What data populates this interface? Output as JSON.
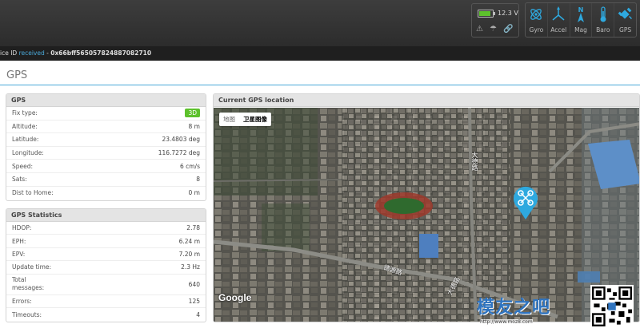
{
  "header": {
    "voltage": "12.3 V",
    "battery_level": 0.85,
    "sensors": [
      {
        "label": "Gyro",
        "icon": "gyro-icon"
      },
      {
        "label": "Accel",
        "icon": "accel-icon"
      },
      {
        "label": "Mag",
        "icon": "mag-icon"
      },
      {
        "label": "Baro",
        "icon": "baro-icon"
      },
      {
        "label": "GPS",
        "icon": "gps-icon"
      }
    ]
  },
  "device": {
    "prefix": "ice ID ",
    "received": "received",
    "separator": " - ",
    "id": "0x66bff565057824887082710"
  },
  "page": {
    "title": "GPS"
  },
  "gps": {
    "title": "GPS",
    "fix_label": "Fix type:",
    "fix_value": "3D",
    "rows": [
      {
        "label": "Altitude:",
        "value": "8 m"
      },
      {
        "label": "Latitude:",
        "value": "23.4803 deg"
      },
      {
        "label": "Longitude:",
        "value": "116.7272 deg"
      },
      {
        "label": "Speed:",
        "value": "6 cm/s"
      },
      {
        "label": "Sats:",
        "value": "8"
      },
      {
        "label": "Dist to Home:",
        "value": "0 m"
      }
    ]
  },
  "stats": {
    "title": "GPS Statistics",
    "rows": [
      {
        "label": "HDOP:",
        "value": "2.78"
      },
      {
        "label": "EPH:",
        "value": "6.24 m"
      },
      {
        "label": "EPV:",
        "value": "7.20 m"
      },
      {
        "label": "Update time:",
        "value": "2.3 Hz"
      }
    ],
    "total_label_1": "Total",
    "total_label_2": "messages:",
    "total_value": "640",
    "rows2": [
      {
        "label": "Errors:",
        "value": "125"
      },
      {
        "label": "Timeouts:",
        "value": "4"
      }
    ]
  },
  "map": {
    "title": "Current GPS location",
    "toggle_map": "地图",
    "toggle_satellite": "卫星图像",
    "google": "Google",
    "road1": "大德路",
    "road2": "德源路",
    "road3": "大德路"
  },
  "watermark": {
    "text": "模友之吧",
    "url": "http://www.moz8.com"
  },
  "colors": {
    "accent": "#4aa8d8",
    "fix_badge": "#5dc12c",
    "marker": "#2ea9df"
  }
}
